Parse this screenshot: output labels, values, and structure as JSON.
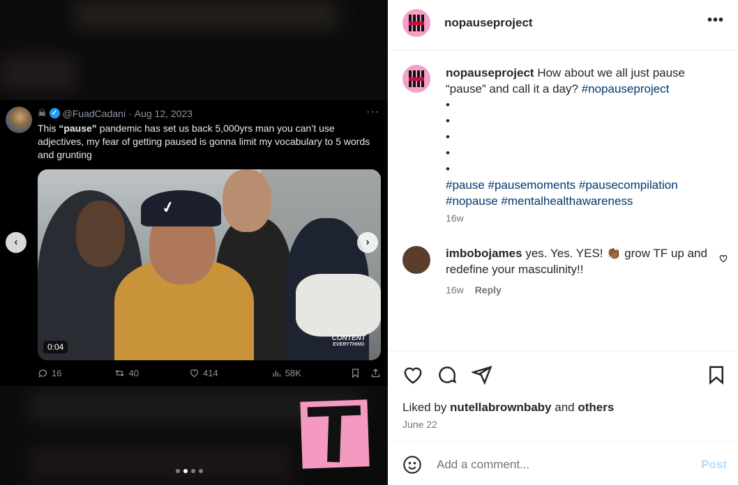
{
  "media": {
    "tweet": {
      "skull_icon": "☠",
      "handle": "@FuadCadani",
      "separator": "·",
      "date": "Aug 12, 2023",
      "text_before": "This ",
      "text_bold": "“pause”",
      "text_after": " pandemic has set us back 5,000yrs man you can’t use adjectives, my fear of getting paused is gonna limit my vocabulary to 5 words and grunting",
      "video_time": "0:04",
      "video_logo_line1": "CONTENT",
      "video_logo_line2": "EVERYTHING",
      "replies": "16",
      "retweets": "40",
      "likes": "414",
      "views": "58K"
    },
    "carousel": {
      "count": 4,
      "active_index": 1
    }
  },
  "post": {
    "username": "nopauseproject",
    "caption_text": "How about we all just pause “pause” and call it a day?",
    "caption_tag": "#nopauseproject",
    "bullets": [
      "•",
      "•",
      "•",
      "•",
      "•"
    ],
    "hashtags_line1": "#pause #pausemoments #pausecompilation",
    "hashtags_line2": "#nopause #mentalhealthawareness",
    "caption_age": "16w",
    "comment": {
      "username": "imbobojames",
      "text": "yes. Yes. YES! 👏🏾 grow TF up and redefine your masculinity!!",
      "age": "16w",
      "reply_label": "Reply"
    },
    "liked_prefix": "Liked by ",
    "liked_user": "nutellabrownbaby",
    "liked_and": " and ",
    "liked_others": "others",
    "date": "June 22",
    "add_comment_placeholder": "Add a comment...",
    "post_label": "Post",
    "colors": {
      "link": "#00376b",
      "muted": "#737373",
      "post_disabled": "#b3dbff",
      "brand_pink": "#f4a0c7"
    }
  }
}
